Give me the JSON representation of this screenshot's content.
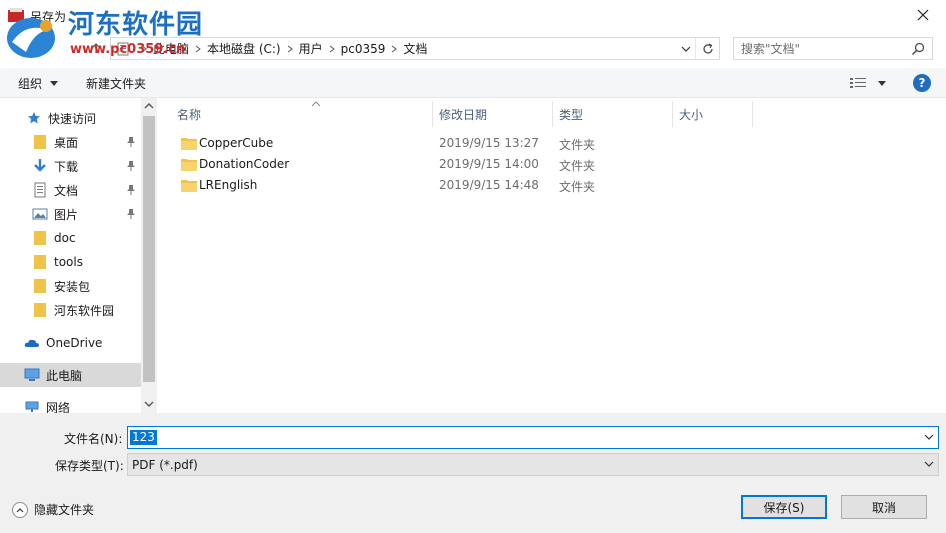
{
  "window": {
    "title": "另存为"
  },
  "watermark": {
    "brand": "河东软件园",
    "url": "www.pc0359.cn"
  },
  "address": {
    "crumbs": [
      "此电脑",
      "本地磁盘 (C:)",
      "用户",
      "pc0359",
      "文档"
    ]
  },
  "search": {
    "placeholder": "搜索\"文档\""
  },
  "toolbar": {
    "organize": "组织",
    "new_folder": "新建文件夹",
    "help": "?"
  },
  "nav": {
    "quick_access": "快速访问",
    "items": [
      {
        "label": "桌面",
        "pinned": true
      },
      {
        "label": "下载",
        "pinned": true
      },
      {
        "label": "文档",
        "pinned": true
      },
      {
        "label": "图片",
        "pinned": true
      },
      {
        "label": "doc",
        "pinned": false
      },
      {
        "label": "tools",
        "pinned": false
      },
      {
        "label": "安装包",
        "pinned": false
      },
      {
        "label": "河东软件园",
        "pinned": false
      }
    ],
    "onedrive": "OneDrive",
    "this_pc": "此电脑",
    "network": "网络"
  },
  "columns": {
    "name": "名称",
    "modified": "修改日期",
    "type": "类型",
    "size": "大小"
  },
  "files": [
    {
      "name": "CopperCube",
      "modified": "2019/9/15 13:27",
      "type": "文件夹"
    },
    {
      "name": "DonationCoder",
      "modified": "2019/9/15 14:00",
      "type": "文件夹"
    },
    {
      "name": "LREnglish",
      "modified": "2019/9/15 14:48",
      "type": "文件夹"
    }
  ],
  "form": {
    "filename_label": "文件名(N):",
    "filename_value": "123",
    "filetype_label": "保存类型(T):",
    "filetype_value": "PDF (*.pdf)"
  },
  "footer": {
    "hide_folders": "隐藏文件夹",
    "save": "保存(S)",
    "cancel": "取消"
  },
  "colors": {
    "accent": "#0078d7",
    "folder": "#f0c34a",
    "watermark_blue": "#1c6fc1",
    "watermark_red": "#cf2a2a"
  }
}
